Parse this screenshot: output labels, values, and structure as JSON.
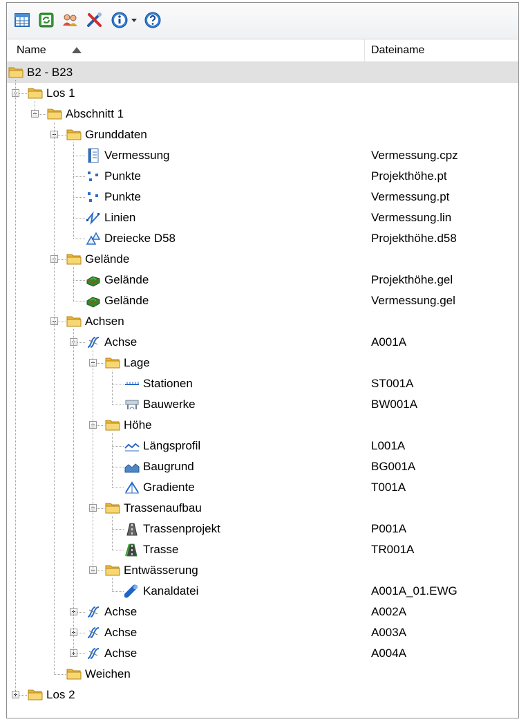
{
  "header": {
    "col_name": "Name",
    "col_filename": "Dateiname"
  },
  "toolbar": {
    "icons": [
      "table-icon",
      "refresh-icon",
      "users-icon",
      "tools-icon",
      "info-icon",
      "dropdown-arrow-icon",
      "help-icon"
    ]
  },
  "tree": [
    {
      "label": "B2 - B23",
      "filename": "",
      "level": 0,
      "icon": "folder-icon",
      "exp": "none",
      "selected": true
    },
    {
      "label": "Los 1",
      "filename": "",
      "level": 1,
      "icon": "folder-icon",
      "exp": "minus"
    },
    {
      "label": "Abschnitt 1",
      "filename": "",
      "level": 2,
      "icon": "folder-icon",
      "exp": "minus"
    },
    {
      "label": "Grunddaten",
      "filename": "",
      "level": 3,
      "icon": "folder-icon",
      "exp": "minus"
    },
    {
      "label": "Vermessung",
      "filename": "Vermessung.cpz",
      "level": 4,
      "icon": "survey-icon",
      "exp": "none"
    },
    {
      "label": "Punkte",
      "filename": "Projekthöhe.pt",
      "level": 4,
      "icon": "points-icon",
      "exp": "none"
    },
    {
      "label": "Punkte",
      "filename": "Vermessung.pt",
      "level": 4,
      "icon": "points-icon",
      "exp": "none"
    },
    {
      "label": "Linien",
      "filename": "Vermessung.lin",
      "level": 4,
      "icon": "lines-icon",
      "exp": "none"
    },
    {
      "label": "Dreiecke D58",
      "filename": "Projekthöhe.d58",
      "level": 4,
      "icon": "triangles-icon",
      "exp": "none"
    },
    {
      "label": "Gelände",
      "filename": "",
      "level": 3,
      "icon": "folder-icon",
      "exp": "minus"
    },
    {
      "label": "Gelände",
      "filename": "Projekthöhe.gel",
      "level": 4,
      "icon": "terrain-icon",
      "exp": "none"
    },
    {
      "label": "Gelände",
      "filename": "Vermessung.gel",
      "level": 4,
      "icon": "terrain-icon",
      "exp": "none"
    },
    {
      "label": "Achsen",
      "filename": "",
      "level": 3,
      "icon": "folder-icon",
      "exp": "minus"
    },
    {
      "label": "Achse",
      "filename": "A001A",
      "level": 4,
      "icon": "axis-icon",
      "exp": "minus"
    },
    {
      "label": "Lage",
      "filename": "",
      "level": 5,
      "icon": "folder-icon",
      "exp": "minus"
    },
    {
      "label": "Stationen",
      "filename": "ST001A",
      "level": 6,
      "icon": "stations-icon",
      "exp": "none"
    },
    {
      "label": "Bauwerke",
      "filename": "BW001A",
      "level": 6,
      "icon": "structures-icon",
      "exp": "none"
    },
    {
      "label": "Höhe",
      "filename": "",
      "level": 5,
      "icon": "folder-icon",
      "exp": "minus"
    },
    {
      "label": "Längsprofil",
      "filename": "L001A",
      "level": 6,
      "icon": "profile-icon",
      "exp": "none"
    },
    {
      "label": "Baugrund",
      "filename": "BG001A",
      "level": 6,
      "icon": "subsoil-icon",
      "exp": "none"
    },
    {
      "label": "Gradiente",
      "filename": "T001A",
      "level": 6,
      "icon": "gradient-icon",
      "exp": "none"
    },
    {
      "label": "Trassenaufbau",
      "filename": "",
      "level": 5,
      "icon": "folder-icon",
      "exp": "minus"
    },
    {
      "label": "Trassenprojekt",
      "filename": "P001A",
      "level": 6,
      "icon": "route-project-icon",
      "exp": "none"
    },
    {
      "label": "Trasse",
      "filename": "TR001A",
      "level": 6,
      "icon": "route-icon",
      "exp": "none"
    },
    {
      "label": "Entwässerung",
      "filename": "",
      "level": 5,
      "icon": "folder-icon",
      "exp": "minus"
    },
    {
      "label": "Kanaldatei",
      "filename": "A001A_01.EWG",
      "level": 6,
      "icon": "pipe-icon",
      "exp": "none"
    },
    {
      "label": "Achse",
      "filename": "A002A",
      "level": 4,
      "icon": "axis-icon",
      "exp": "plus"
    },
    {
      "label": "Achse",
      "filename": "A003A",
      "level": 4,
      "icon": "axis-icon",
      "exp": "plus"
    },
    {
      "label": "Achse",
      "filename": "A004A",
      "level": 4,
      "icon": "axis-icon",
      "exp": "plus"
    },
    {
      "label": "Weichen",
      "filename": "",
      "level": 3,
      "icon": "folder-icon",
      "exp": "none"
    },
    {
      "label": "Los 2",
      "filename": "",
      "level": 1,
      "icon": "folder-icon",
      "exp": "plus"
    }
  ],
  "colors": {
    "folder": "#f7d774",
    "selection": "#e1e1e1"
  }
}
